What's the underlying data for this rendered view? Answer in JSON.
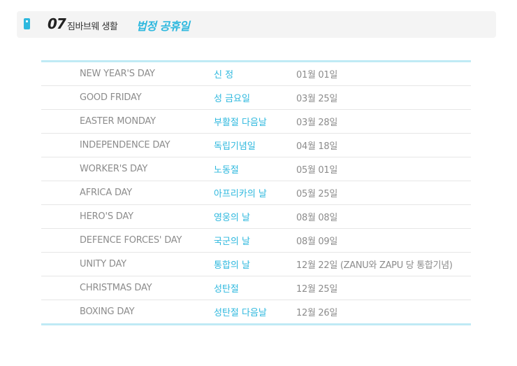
{
  "header": {
    "number": "07",
    "section": "짐바브웨 생활",
    "title": "법정 공휴일"
  },
  "holidays": [
    {
      "en": "NEW YEAR'S DAY",
      "ko": "신 정",
      "date": "01월 01일"
    },
    {
      "en": "GOOD FRIDAY",
      "ko": "성 금요일",
      "date": "03월 25일"
    },
    {
      "en": "EASTER MONDAY",
      "ko": "부활절 다음날",
      "date": "03월 28일"
    },
    {
      "en": "INDEPENDENCE DAY",
      "ko": "독립기념일",
      "date": "04월 18일"
    },
    {
      "en": "WORKER'S DAY",
      "ko": "노동절",
      "date": "05월 01일"
    },
    {
      "en": "AFRICA DAY",
      "ko": "아프리카의 날",
      "date": "05월 25일"
    },
    {
      "en": "HERO'S DAY",
      "ko": "영웅의 날",
      "date": "08월 08일"
    },
    {
      "en": "DEFENCE FORCES' DAY",
      "ko": "국군의 날",
      "date": "08월 09일"
    },
    {
      "en": "UNITY DAY",
      "ko": "통합의 날",
      "date": "12월 22일 (ZANU와 ZAPU 당 통합기념)"
    },
    {
      "en": "CHRISTMAS DAY",
      "ko": "성탄절",
      "date": "12월 25일"
    },
    {
      "en": "BOXING DAY",
      "ko": "성탄절 다음날",
      "date": "12월 26일"
    }
  ]
}
